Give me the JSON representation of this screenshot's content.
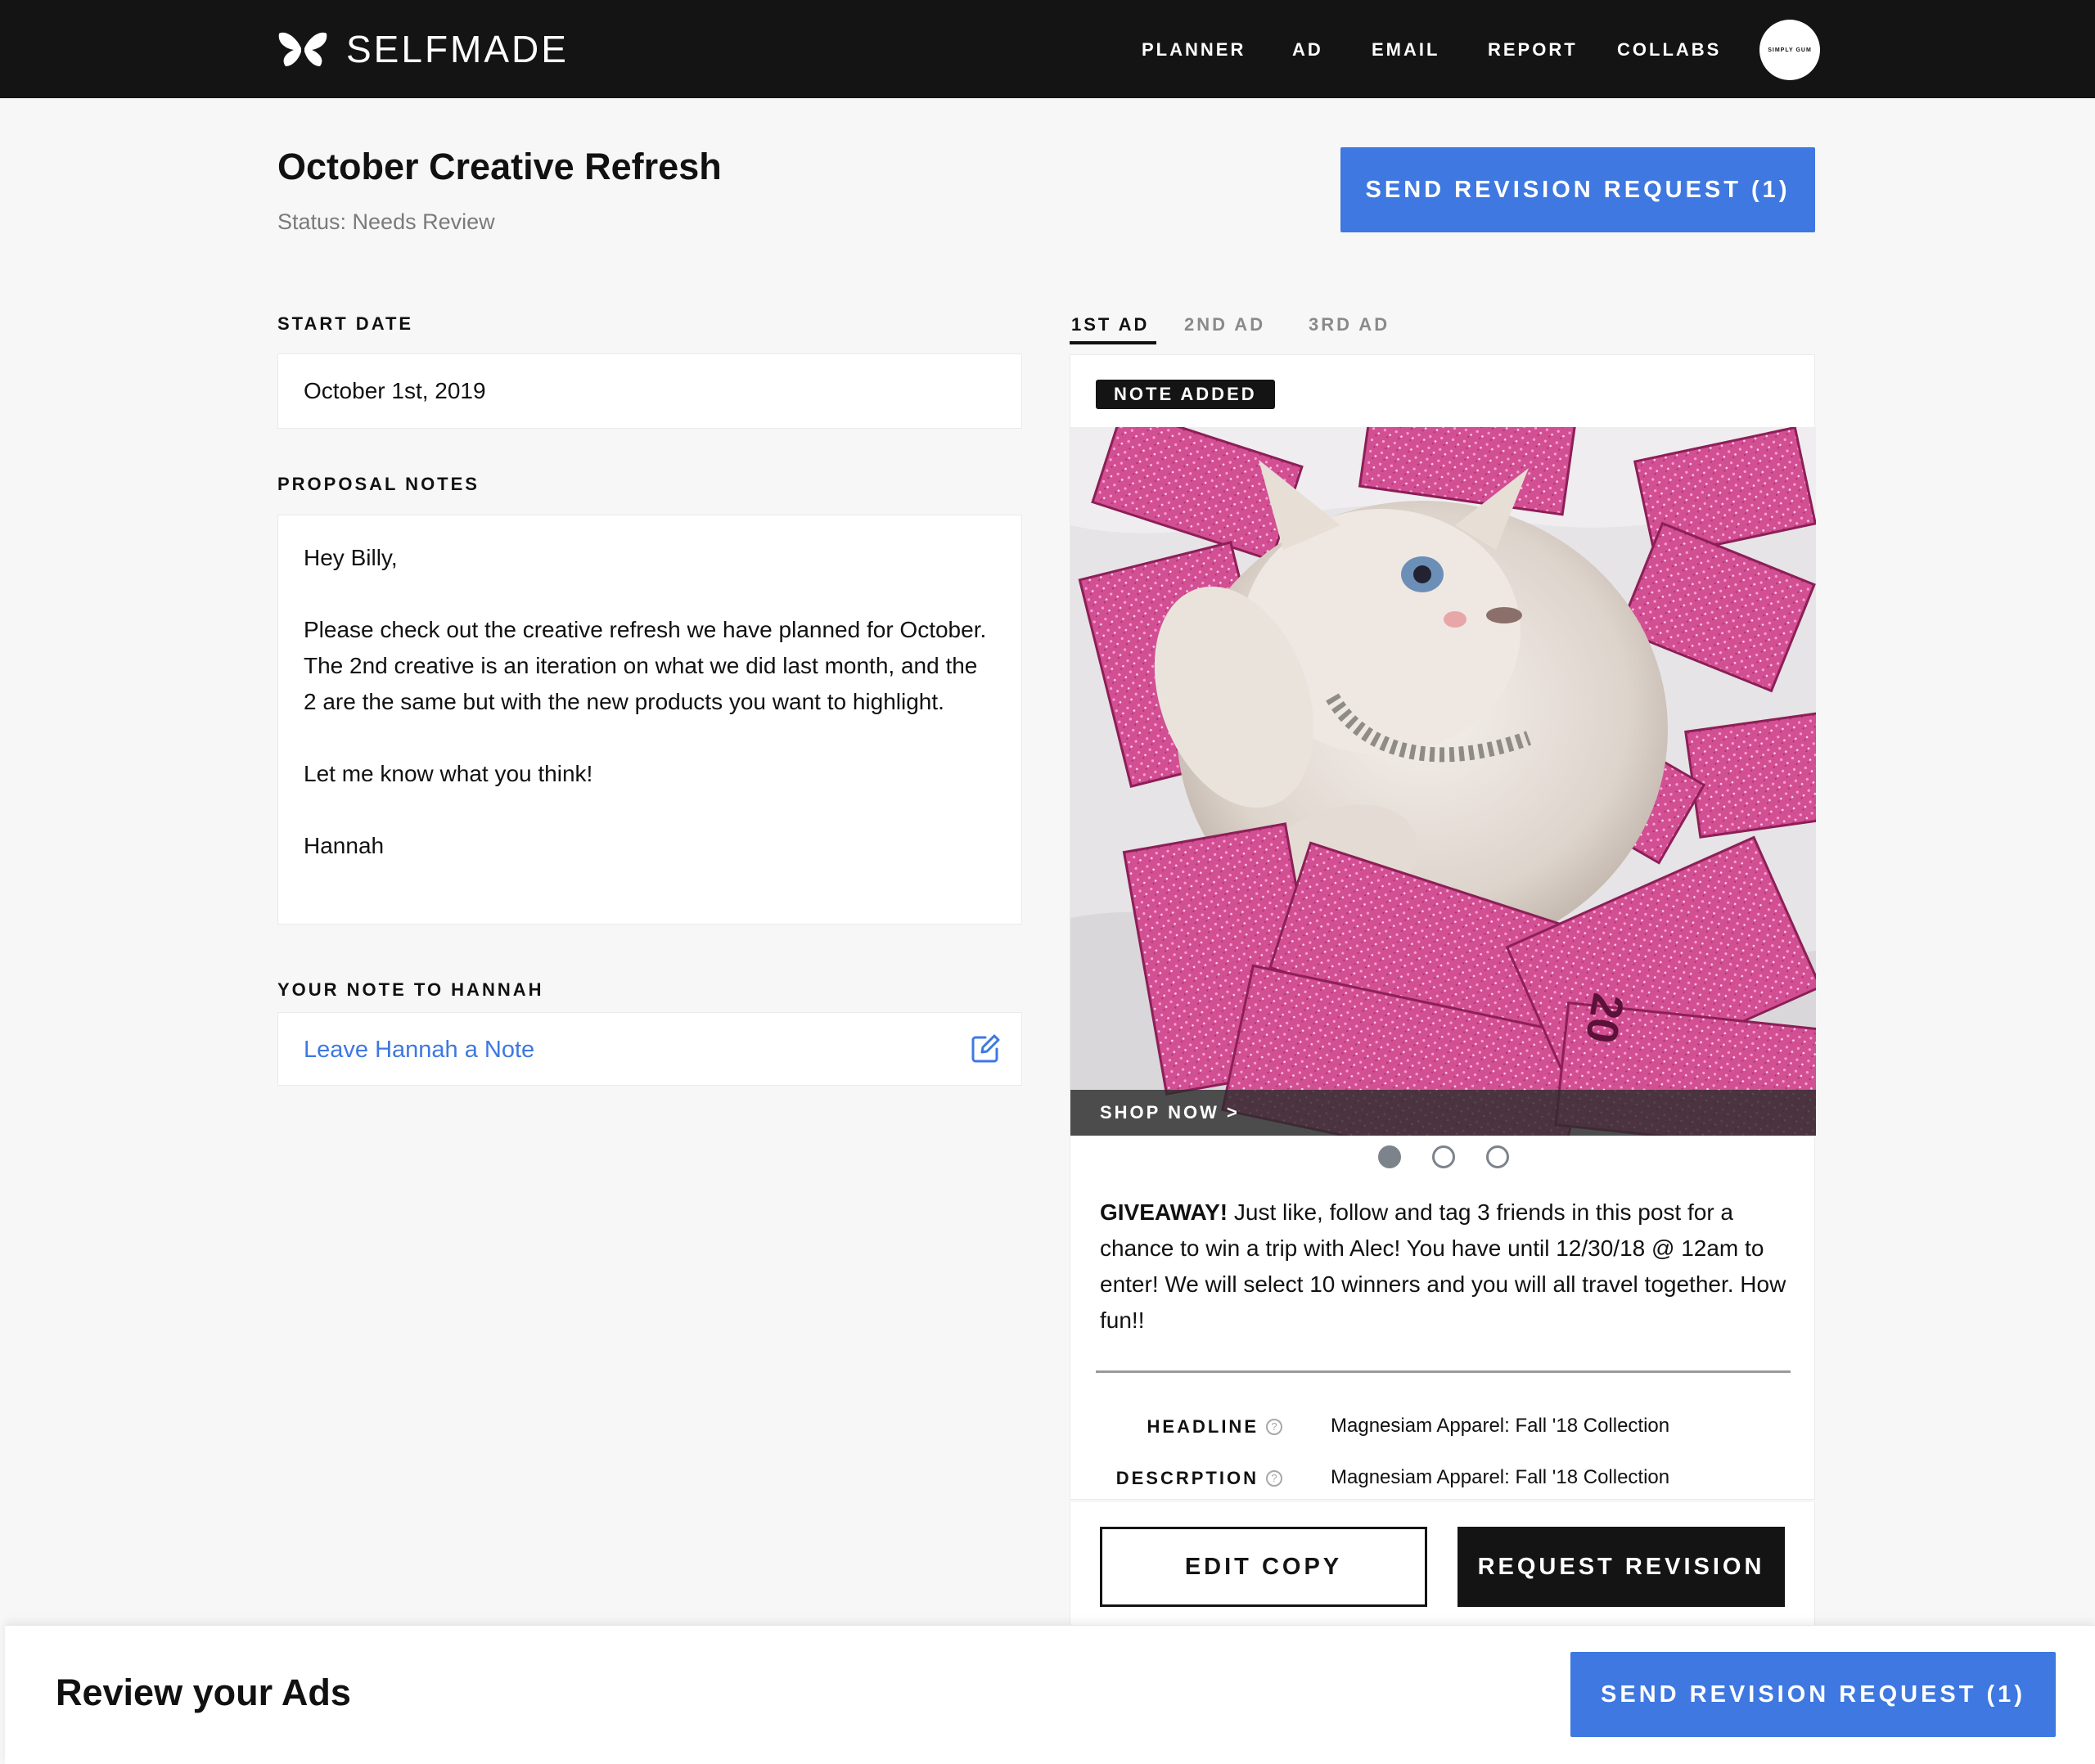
{
  "nav": {
    "logo_text": "SELFMADE",
    "items": [
      "PLANNER",
      "AD",
      "EMAIL",
      "REPORT",
      "COLLABS"
    ],
    "avatar_text": "SIMPLY GUM"
  },
  "header": {
    "title": "October Creative Refresh",
    "status": "Status: Needs Review",
    "send_button": "SEND REVISION REQUEST (1)"
  },
  "left": {
    "start_date_label": "START DATE",
    "start_date": "October 1st, 2019",
    "proposal_notes_label": "PROPOSAL NOTES",
    "proposal_notes": [
      "Hey Billy,",
      "Please check out the creative refresh we have planned for October. The 2nd creative is an iteration on what we did last month, and the 2 are the same but with the new products you want to highlight.",
      "Let me know what you think!",
      "Hannah"
    ],
    "your_note_label": "YOUR NOTE TO HANNAH",
    "note_placeholder": "Leave Hannah a Note"
  },
  "ad": {
    "tabs": [
      "1ST AD",
      "2ND AD",
      "3RD AD"
    ],
    "active_tab": 0,
    "badge": "NOTE ADDED",
    "cta": "SHOP NOW >",
    "carousel_total": 3,
    "carousel_index": 0,
    "caption_lead": "GIVEAWAY!",
    "caption_body": " Just like, follow and tag 3 friends in this post for a chance to win a trip with Alec! You have until 12/30/18 @ 12am to enter! We will select 10 winners and you will all travel together. How fun!!",
    "meta": [
      {
        "key": "HEADLINE",
        "value": "Magnesiam Apparel: Fall '18 Collection"
      },
      {
        "key": "DESCRPTION",
        "value": "Magnesiam Apparel: Fall '18 Collection"
      }
    ],
    "edit_button": "EDIT COPY",
    "revision_button": "REQUEST REVISION"
  },
  "bottom": {
    "title": "Review your Ads",
    "send_button": "SEND REVISION REQUEST (1)"
  },
  "colors": {
    "accent": "#3e78e0",
    "dark": "#141414",
    "pink": "#d9539a"
  }
}
